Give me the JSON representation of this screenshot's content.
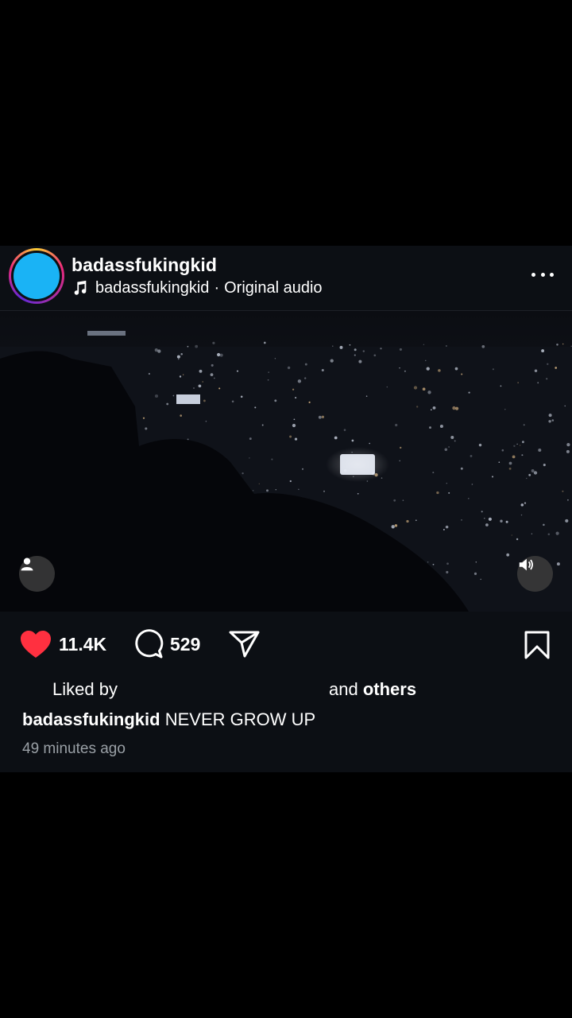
{
  "post": {
    "username": "badassfukingkid",
    "audio": {
      "artist": "badassfukingkid",
      "separator": "·",
      "title": "Original audio"
    },
    "more_icon": "more-horizontal-icon",
    "avatar_color": "#1ab3f5"
  },
  "actions": {
    "like_count": "11.4K",
    "comment_count": "529",
    "like_color": "#ff3040"
  },
  "likes": {
    "prefix": "Liked by",
    "and": "and",
    "others": "others"
  },
  "caption": {
    "user": "badassfukingkid",
    "text": "NEVER GROW UP"
  },
  "timestamp": "49 minutes ago"
}
